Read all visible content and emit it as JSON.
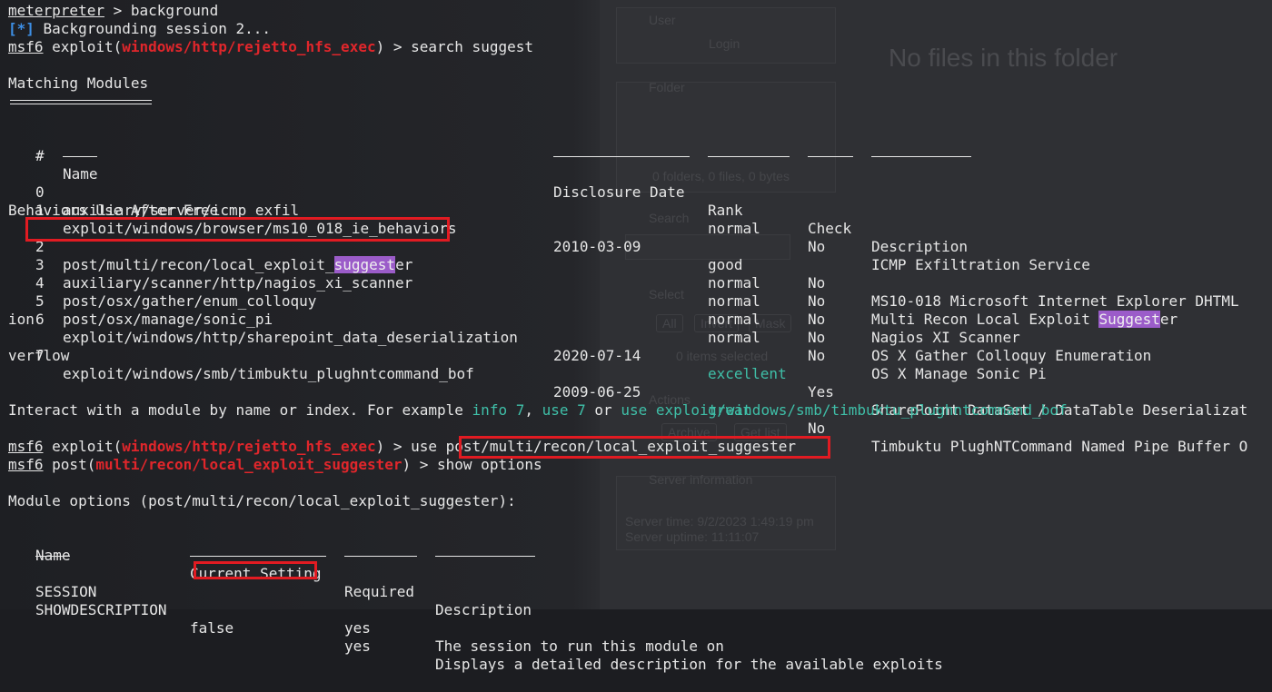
{
  "terminal": {
    "line_background": {
      "prompt": "meterpreter",
      "rest": " > background"
    },
    "line_bgsession": {
      "tag": "[*]",
      "text": " Backgrounding session 2..."
    },
    "line_search": {
      "prompt": "msf6",
      "pre": " exploit(",
      "module": "windows/http/rejetto_hfs_exec",
      "post": ") > search suggest"
    },
    "matching_title": "Matching Modules",
    "headers": {
      "num": "#",
      "name": "Name",
      "date": "Disclosure Date",
      "rank": "Rank",
      "check": "Check",
      "description": "Description"
    },
    "dash": "-",
    "rows": [
      {
        "num": "0",
        "name": "auxiliary/server/icmp_exfil",
        "date": "",
        "rank": "normal",
        "check": "No",
        "desc": "ICMP Exfiltration Service"
      },
      {
        "num": "1",
        "name": "exploit/windows/browser/ms10_018_ie_behaviors",
        "date": "2010-03-09",
        "rank": "good",
        "check": "No",
        "desc": "MS10-018 Microsoft Internet Explorer DHTML",
        "wrap": "Behaviors Use After Free"
      },
      {
        "num": "2",
        "name_pre": "post/multi/recon/local_exploit_",
        "name_hl": "suggest",
        "name_post": "er",
        "rank": "normal",
        "check": "No",
        "desc_pre": "Multi Recon Local Exploit ",
        "desc_hl": "Suggest",
        "desc_post": "er"
      },
      {
        "num": "3",
        "name": "auxiliary/scanner/http/nagios_xi_scanner",
        "date": "",
        "rank": "normal",
        "check": "No",
        "desc": "Nagios XI Scanner"
      },
      {
        "num": "4",
        "name": "post/osx/gather/enum_colloquy",
        "date": "",
        "rank": "normal",
        "check": "No",
        "desc": "OS X Gather Colloquy Enumeration"
      },
      {
        "num": "5",
        "name": "post/osx/manage/sonic_pi",
        "date": "",
        "rank": "normal",
        "check": "No",
        "desc": "OS X Manage Sonic Pi"
      },
      {
        "num": "6",
        "name": "exploit/windows/http/sharepoint_data_deserialization",
        "date": "2020-07-14",
        "rank": "excellent",
        "check": "Yes",
        "desc": "SharePoint DataSet / DataTable Deserializat",
        "wrap": "ion"
      },
      {
        "num": "7",
        "name": "exploit/windows/smb/timbuktu_plughntcommand_bof",
        "date": "2009-06-25",
        "rank": "great",
        "check": "No",
        "desc": "Timbuktu PlughNTCommand Named Pipe Buffer O",
        "wrap": "verflow"
      }
    ],
    "interact": {
      "pre": "Interact with a module by name or index. For example ",
      "info": "info 7",
      "c1": ", ",
      "use7": "use 7",
      "or": " or ",
      "usefull": "use exploit/windows/smb/timbuktu_plughntcommand_bof"
    },
    "line_use": {
      "prompt": "msf6",
      "pre": " exploit(",
      "module": "windows/http/rejetto_hfs_exec",
      "post": ") > use ",
      "arg": "post/multi/recon/local_exploit_suggester"
    },
    "line_show": {
      "prompt": "msf6",
      "pre": " post(",
      "module": "multi/recon/local_exploit_suggester",
      "post": ") > show options"
    },
    "options_title": "Module options (post/multi/recon/local_exploit_suggester):",
    "opt_headers": {
      "name": "Name",
      "setting": "Current Setting",
      "required": "Required",
      "description": "Description"
    },
    "options": [
      {
        "name": "SESSION",
        "setting": "",
        "required": "yes",
        "desc": "The session to run this module on"
      },
      {
        "name": "SHOWDESCRIPTION",
        "setting": "false",
        "required": "yes",
        "desc": "Displays a detailed description for the available exploits"
      }
    ]
  },
  "background_page": {
    "user": "User",
    "login": "Login",
    "no_files": "No files in this folder",
    "folder": "Folder",
    "folder_info": "0 folders, 0 files, 0 bytes",
    "search": "Search",
    "select": "Select",
    "btn_all": "All",
    "btn_invert": "Invert",
    "btn_mask": "Mask",
    "items_selected": "0 items selected",
    "actions": "Actions",
    "btn_archive": "Archive",
    "btn_getlist": "Get list",
    "server_info": "Server information",
    "server_time": "Server time: 9/2/2023 1:49:19 pm",
    "server_uptime": "Server uptime: 11:11:07"
  },
  "colors": {
    "prompt_module": "#e0262b",
    "info_tag": "#3d8fe6",
    "rank_green": "#3fbfa8",
    "highlight": "#9b5cc9",
    "annotation_box": "#e11b22"
  }
}
